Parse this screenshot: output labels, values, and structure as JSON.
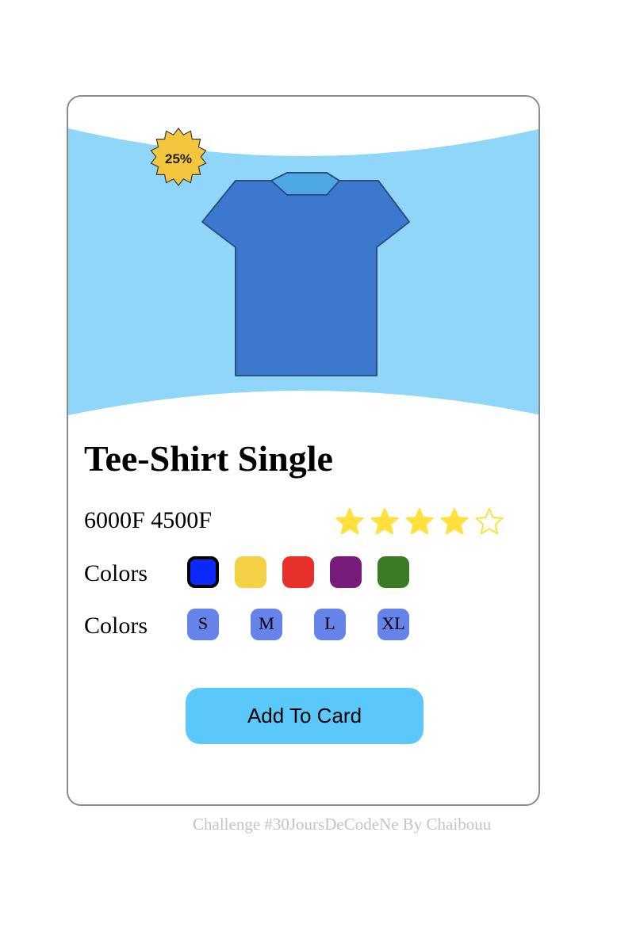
{
  "product": {
    "discount_badge": "25%",
    "title": "Tee-Shirt Single",
    "old_price": "6000F",
    "new_price": "4500F",
    "rating": 4,
    "rating_max": 5
  },
  "colors": {
    "label": "Colors",
    "options": [
      {
        "name": "blue",
        "hex": "#0a28ff",
        "selected": true
      },
      {
        "name": "yellow",
        "hex": "#f5d245",
        "selected": false
      },
      {
        "name": "red",
        "hex": "#e8302b",
        "selected": false
      },
      {
        "name": "purple",
        "hex": "#771c7b",
        "selected": false
      },
      {
        "name": "green",
        "hex": "#3a7c24",
        "selected": false
      }
    ]
  },
  "sizes": {
    "label": "Colors",
    "options": [
      "S",
      "M",
      "L",
      "XL"
    ]
  },
  "cta": {
    "label": "Add To Card"
  },
  "footer": {
    "credit": "Challenge #30JoursDeCodeNe By Chaibouu"
  },
  "theme": {
    "hero_bg": "#8fd6f9",
    "shirt": "#3d78cf",
    "collar": "#4ea8e4",
    "badge": "#f3c63d",
    "star": "#ffe03d",
    "button": "#5bc8fa",
    "size_chip": "#6683ea"
  },
  "icons": {
    "tshirt": "tshirt-icon",
    "badge": "starburst-badge-icon",
    "star": "star-icon"
  }
}
